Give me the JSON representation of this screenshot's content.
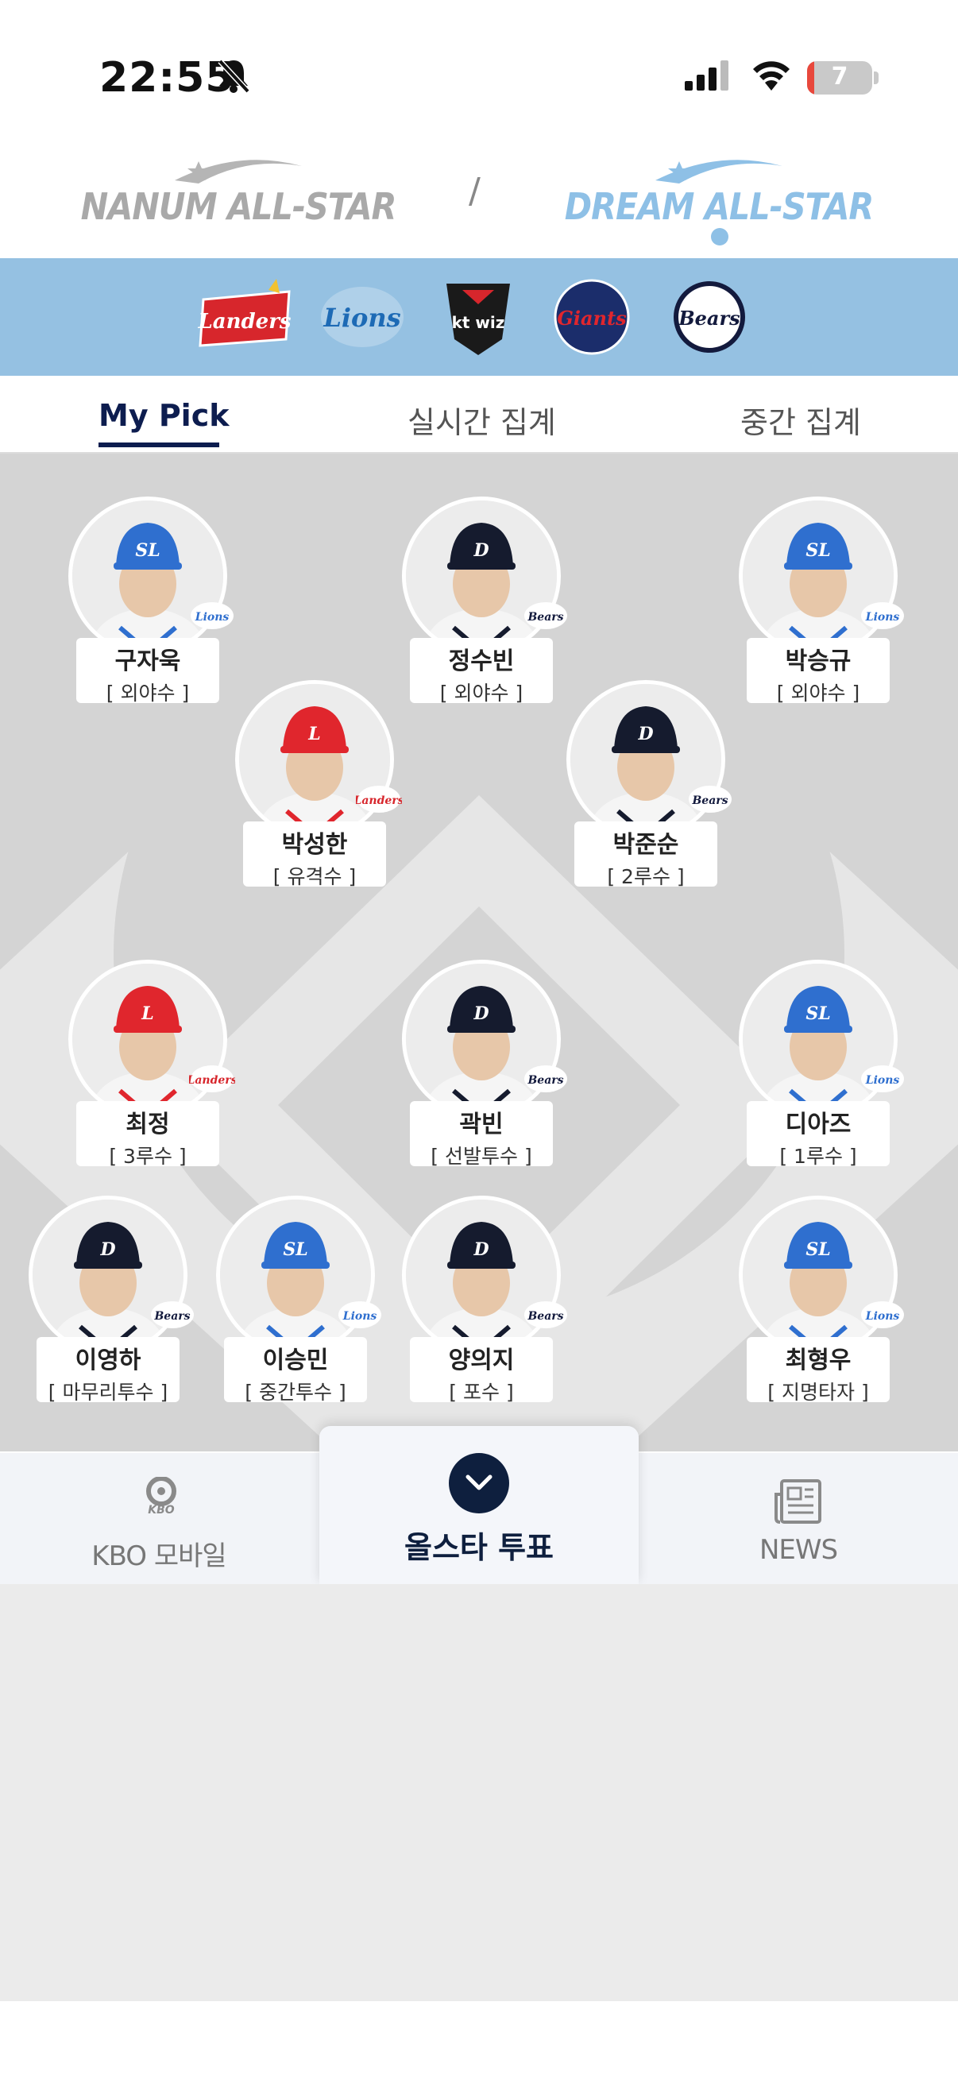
{
  "status_bar": {
    "time": "22:55",
    "battery_level": "7",
    "icons": [
      "bell-muted-icon",
      "signal-icon",
      "wifi-icon",
      "battery-icon"
    ]
  },
  "leagues": {
    "nanum": "NANUM ALL-STAR",
    "separator": "/",
    "dream": "DREAM ALL-STAR",
    "selected": "dream"
  },
  "teams": [
    {
      "name": "SSG Landers",
      "label": "Landers",
      "color": "#d7262c"
    },
    {
      "name": "Samsung Lions",
      "label": "Lions",
      "color": "#1d6ab5"
    },
    {
      "name": "kt wiz",
      "label": "kt wiz",
      "color": "#1a1a1a"
    },
    {
      "name": "Lotte Giants",
      "label": "Giants",
      "color": "#1b2d6b"
    },
    {
      "name": "Doosan Bears",
      "label": "Bears",
      "color": "#131a3d"
    }
  ],
  "tabs": [
    {
      "label": "My Pick",
      "active": true
    },
    {
      "label": "실시간 집계",
      "active": false
    },
    {
      "label": "중간 집계",
      "active": false
    }
  ],
  "players": [
    {
      "name": "구자욱",
      "position": "[ 외야수 ]",
      "team": "Lions"
    },
    {
      "name": "정수빈",
      "position": "[ 외야수 ]",
      "team": "Bears"
    },
    {
      "name": "박승규",
      "position": "[ 외야수 ]",
      "team": "Lions"
    },
    {
      "name": "박성한",
      "position": "[ 유격수 ]",
      "team": "Landers"
    },
    {
      "name": "박준순",
      "position": "[ 2루수 ]",
      "team": "Bears"
    },
    {
      "name": "최정",
      "position": "[ 3루수 ]",
      "team": "Landers"
    },
    {
      "name": "곽빈",
      "position": "[ 선발투수 ]",
      "team": "Bears"
    },
    {
      "name": "디아즈",
      "position": "[ 1루수 ]",
      "team": "Lions"
    },
    {
      "name": "이영하",
      "position": "[ 마무리투수 ]",
      "team": "Bears"
    },
    {
      "name": "이승민",
      "position": "[ 중간투수 ]",
      "team": "Lions"
    },
    {
      "name": "양의지",
      "position": "[ 포수 ]",
      "team": "Bears"
    },
    {
      "name": "최형우",
      "position": "[ 지명타자 ]",
      "team": "Lions"
    }
  ],
  "bottom_nav": {
    "kbo_logo_text": "KBO",
    "kbo_label": "KBO 모바일",
    "vote_label": "올스타 투표",
    "news_label": "NEWS"
  },
  "colors": {
    "accent": "#0d1d4f",
    "team_bar": "#95c1e2",
    "dream": "#8ec0e6",
    "lions_cap": "#2f6fcf",
    "landers_cap": "#e0262d",
    "bears_cap": "#151b2e"
  }
}
